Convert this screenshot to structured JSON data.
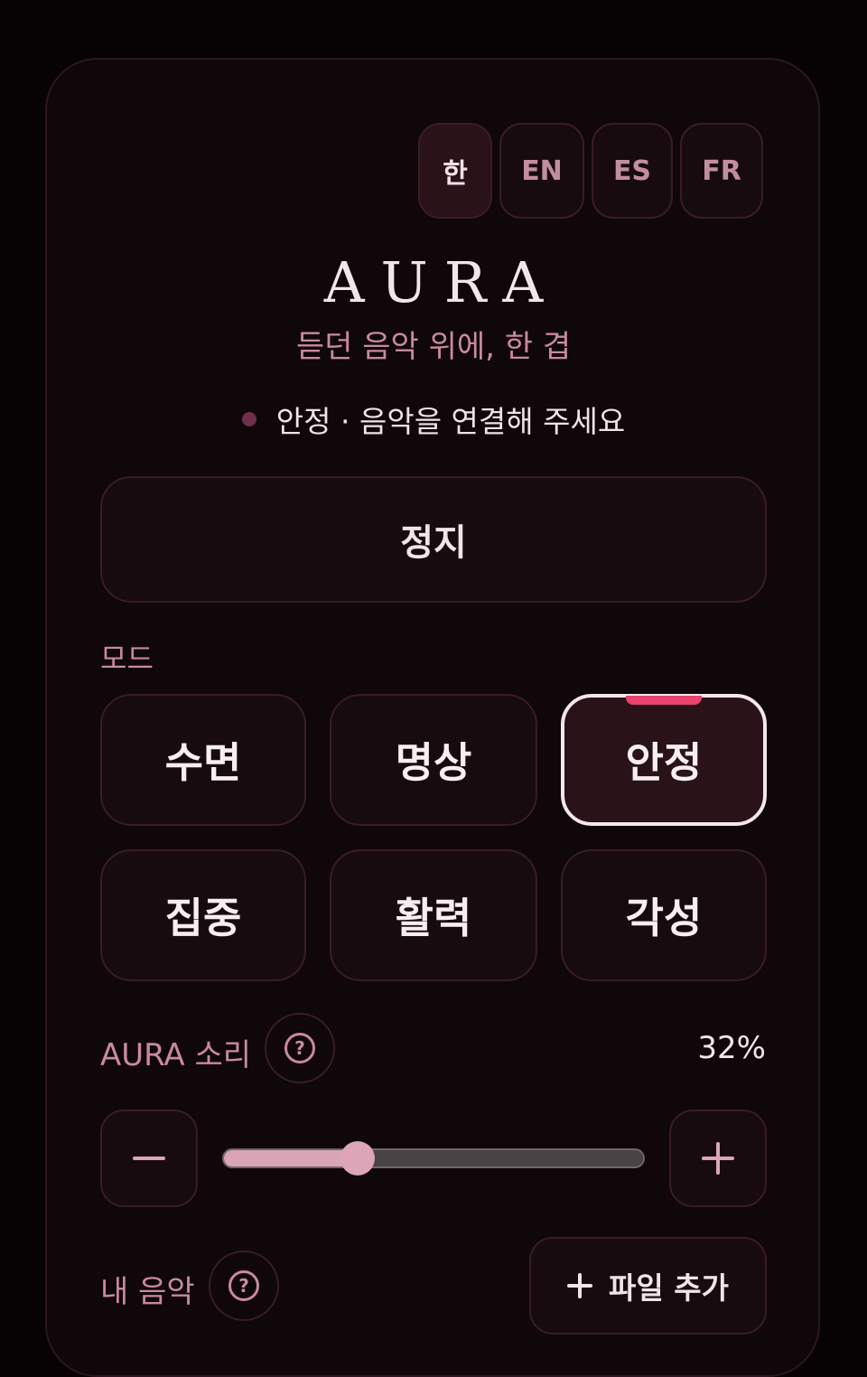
{
  "languages": [
    {
      "label": "한",
      "active": true
    },
    {
      "label": "EN",
      "active": false
    },
    {
      "label": "ES",
      "active": false
    },
    {
      "label": "FR",
      "active": false
    }
  ],
  "header": {
    "title": "AURA",
    "subtitle": "듣던 음악 위에, 한 겹"
  },
  "status": {
    "text": "안정 · 음악을 연결해 주세요",
    "dot_color": "#6d2f4a"
  },
  "stop_button": {
    "label": "정지"
  },
  "modes": {
    "label": "모드",
    "items": [
      {
        "label": "수면",
        "active": false
      },
      {
        "label": "명상",
        "active": false
      },
      {
        "label": "안정",
        "active": true
      },
      {
        "label": "집중",
        "active": false
      },
      {
        "label": "활력",
        "active": false
      },
      {
        "label": "각성",
        "active": false
      }
    ],
    "accent_color": "#e9436e"
  },
  "volume": {
    "label": "AURA 소리",
    "help_icon": "question-circle-icon",
    "value_text": "32%",
    "level": 0.32,
    "decrease_icon": "minus-icon",
    "increase_icon": "plus-icon"
  },
  "my_music": {
    "label": "내 음악",
    "help_icon": "question-circle-icon",
    "add_file_label": "파일 추가",
    "add_icon": "plus-icon"
  }
}
